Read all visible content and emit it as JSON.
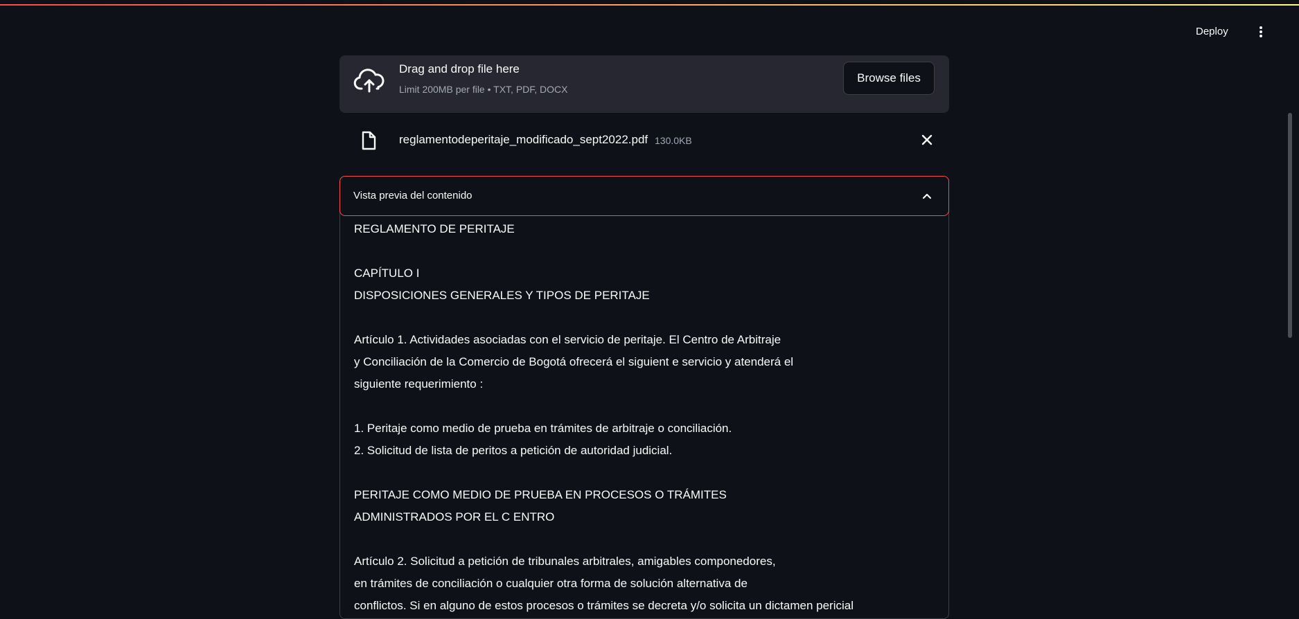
{
  "header": {
    "deploy_label": "Deploy"
  },
  "uploader": {
    "title": "Drag and drop file here",
    "subtitle": "Limit 200MB per file • TXT, PDF, DOCX",
    "browse_label": "Browse files"
  },
  "file": {
    "name": "reglamentodeperitaje_modificado_sept2022.pdf",
    "size": "130.0KB"
  },
  "expander": {
    "label": "Vista previa del contenido",
    "lines": [
      "REGLAMENTO DE PERITAJE",
      "",
      "CAPÍTULO I",
      "DISPOSICIONES GENERALES Y TIPOS DE PERITAJE",
      "",
      "Artículo 1. Actividades asociadas con el servicio de peritaje. El Centro de Arbitraje",
      "y Conciliación de la Comercio de Bogotá ofrecerá el siguient e servicio y atenderá el",
      "siguiente requerimiento :",
      "",
      "1. Peritaje como medio de prueba en trámites de arbitraje o conciliación.",
      "2. Solicitud de lista de peritos a petición de autoridad judicial.",
      "",
      "PERITAJE COMO MEDIO DE PRUEBA EN PROCESOS O TRÁMITES",
      "ADMINISTRADOS POR EL C ENTRO",
      "",
      "Artículo 2. Solicitud a petición de tribunales arbitrales, amigables componedores,",
      "en trámites de conciliación o cualquier otra forma de solución alternativa de",
      "conflictos. Si en alguno de estos procesos o trámites se decreta y/o solicita un dictamen pericial"
    ]
  },
  "colors": {
    "background": "#0e1117",
    "surface": "#262730",
    "accent": "#ff4b4b",
    "text": "#fafafa",
    "muted": "#a3a8b8"
  }
}
